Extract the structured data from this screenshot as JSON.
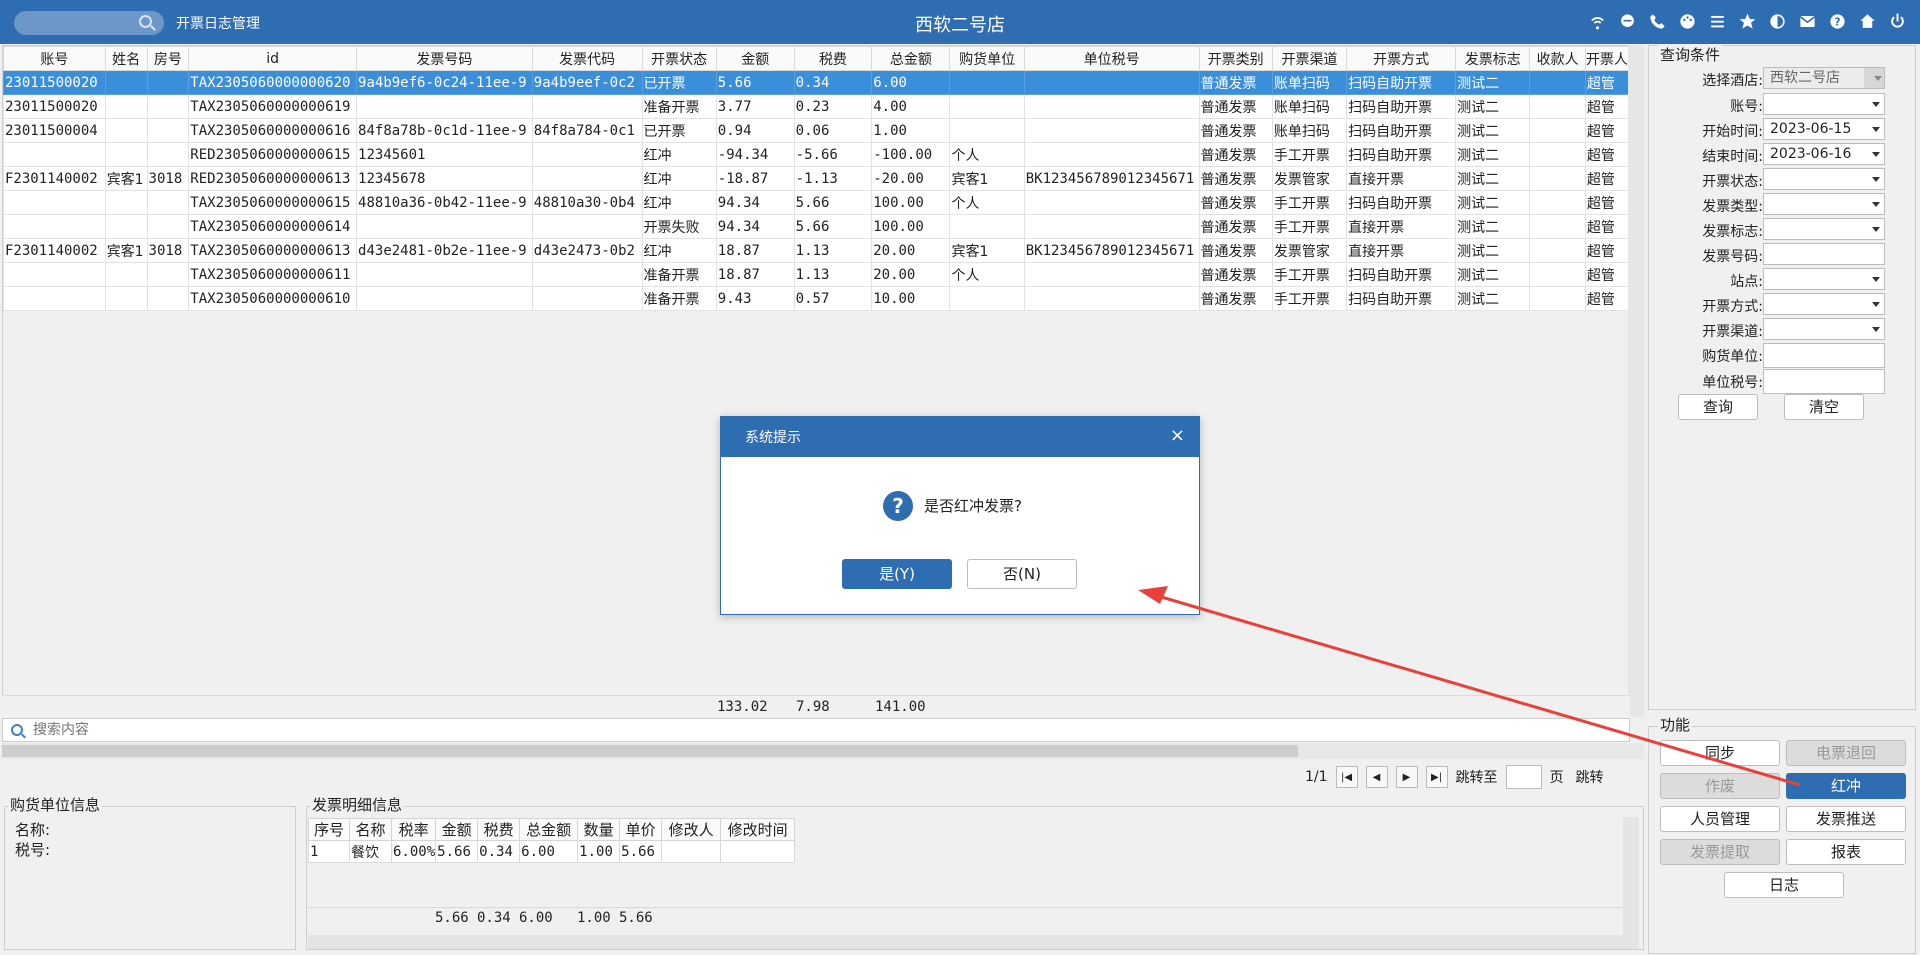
{
  "titlebar": {
    "module": "开票日志管理",
    "title": "西软二号店",
    "icons": [
      "wifi-icon",
      "chat-icon",
      "phone-icon",
      "palette-icon",
      "menu-icon",
      "star-icon",
      "theme-icon",
      "mail-icon",
      "help-icon",
      "home-icon",
      "power-icon"
    ]
  },
  "grid": {
    "columns": [
      "账号",
      "姓名",
      "房号",
      "id",
      "发票号码",
      "发票代码",
      "开票状态",
      "金额",
      "税费",
      "总金额",
      "购货单位",
      "单位税号",
      "开票类别",
      "开票渠道",
      "开票方式",
      "发票标志",
      "收款人",
      "开票人"
    ],
    "rows": [
      [
        "23011500020",
        "",
        "",
        "TAX2305060000000620",
        "9a4b9ef6-0c24-11ee-9",
        "9a4b9eef-0c2",
        "已开票",
        "5.66",
        "0.34",
        "6.00",
        "",
        "",
        "普通发票",
        "账单扫码",
        "扫码自助开票",
        "测试二",
        "",
        "超管"
      ],
      [
        "23011500020",
        "",
        "",
        "TAX2305060000000619",
        "",
        "",
        "准备开票",
        "3.77",
        "0.23",
        "4.00",
        "",
        "",
        "普通发票",
        "账单扫码",
        "扫码自助开票",
        "测试二",
        "",
        "超管"
      ],
      [
        "23011500004",
        "",
        "",
        "TAX2305060000000616",
        "84f8a78b-0c1d-11ee-9",
        "84f8a784-0c1",
        "已开票",
        "0.94",
        "0.06",
        "1.00",
        "",
        "",
        "普通发票",
        "账单扫码",
        "扫码自助开票",
        "测试二",
        "",
        "超管"
      ],
      [
        "",
        "",
        "",
        "RED2305060000000615",
        "12345601",
        "",
        "红冲",
        "-94.34",
        "-5.66",
        "-100.00",
        "个人",
        "",
        "普通发票",
        "手工开票",
        "扫码自助开票",
        "测试二",
        "",
        "超管"
      ],
      [
        "F2301140002",
        "宾客1",
        "3018",
        "RED2305060000000613",
        "12345678",
        "",
        "红冲",
        "-18.87",
        "-1.13",
        "-20.00",
        "宾客1",
        "BK123456789012345671",
        "普通发票",
        "发票管家",
        "直接开票",
        "测试二",
        "",
        "超管"
      ],
      [
        "",
        "",
        "",
        "TAX2305060000000615",
        "48810a36-0b42-11ee-9",
        "48810a30-0b4",
        "红冲",
        "94.34",
        "5.66",
        "100.00",
        "个人",
        "",
        "普通发票",
        "手工开票",
        "扫码自助开票",
        "测试二",
        "",
        "超管"
      ],
      [
        "",
        "",
        "",
        "TAX2305060000000614",
        "",
        "",
        "开票失败",
        "94.34",
        "5.66",
        "100.00",
        "",
        "",
        "普通发票",
        "手工开票",
        "直接开票",
        "测试二",
        "",
        "超管"
      ],
      [
        "F2301140002",
        "宾客1",
        "3018",
        "TAX2305060000000613",
        "d43e2481-0b2e-11ee-9",
        "d43e2473-0b2",
        "红冲",
        "18.87",
        "1.13",
        "20.00",
        "宾客1",
        "BK123456789012345671",
        "普通发票",
        "发票管家",
        "直接开票",
        "测试二",
        "",
        "超管"
      ],
      [
        "",
        "",
        "",
        "TAX2305060000000611",
        "",
        "",
        "准备开票",
        "18.87",
        "1.13",
        "20.00",
        "个人",
        "",
        "普通发票",
        "手工开票",
        "扫码自助开票",
        "测试二",
        "",
        "超管"
      ],
      [
        "",
        "",
        "",
        "TAX2305060000000610",
        "",
        "",
        "准备开票",
        "9.43",
        "0.57",
        "10.00",
        "",
        "",
        "普通发票",
        "手工开票",
        "扫码自助开票",
        "测试二",
        "",
        "超管"
      ]
    ],
    "totals": {
      "amount": "133.02",
      "tax": "7.98",
      "total": "141.00"
    },
    "search_placeholder": "搜索内容"
  },
  "pager": {
    "page": "1/1",
    "first": "|◀",
    "prev": "◀",
    "next": "▶",
    "last": "▶|",
    "jump_label": "跳转至",
    "page_unit": "页",
    "jump_button": "跳转"
  },
  "query": {
    "title": "查询条件",
    "hotel_label": "选择酒店:",
    "hotel_value": "西软二号店",
    "account_label": "账号:",
    "start_label": "开始时间:",
    "start_value": "2023-06-15",
    "end_label": "结束时间:",
    "end_value": "2023-06-16",
    "status_label": "开票状态:",
    "type_label": "发票类型:",
    "flag_label": "发票标志:",
    "number_label": "发票号码:",
    "station_label": "站点:",
    "method_label": "开票方式:",
    "channel_label": "开票渠道:",
    "buyer_label": "购货单位:",
    "taxno_label": "单位税号:",
    "search_button": "查询",
    "clear_button": "清空"
  },
  "functions": {
    "title": "功能",
    "sync": "同步",
    "refund": "电票退回",
    "void": "作废",
    "redflush": "红冲",
    "staff": "人员管理",
    "push": "发票推送",
    "extract": "发票提取",
    "report": "报表",
    "log": "日志"
  },
  "buyer": {
    "title": "购货单位信息",
    "name_label": "名称:",
    "taxno_label": "税号:"
  },
  "detail": {
    "title": "发票明细信息",
    "columns": [
      "序号",
      "名称",
      "税率",
      "金额",
      "税费",
      "总金额",
      "数量",
      "单价",
      "修改人",
      "修改时间"
    ],
    "rows": [
      [
        "1",
        "餐饮",
        "6.00%",
        "5.66",
        "0.34",
        "6.00",
        "1.00",
        "5.66",
        "",
        ""
      ]
    ],
    "totals": {
      "amount": "5.66",
      "tax": "0.34",
      "total": "6.00",
      "qty": "1.00",
      "price": "5.66"
    }
  },
  "dialog": {
    "title": "系统提示",
    "close": "×",
    "message": "是否红冲发票?",
    "yes": "是(Y)",
    "no": "否(N)"
  },
  "colors": {
    "brand": "#2f6db3",
    "selected_row": "#3b8ed9",
    "arrow": "#e8403a"
  }
}
